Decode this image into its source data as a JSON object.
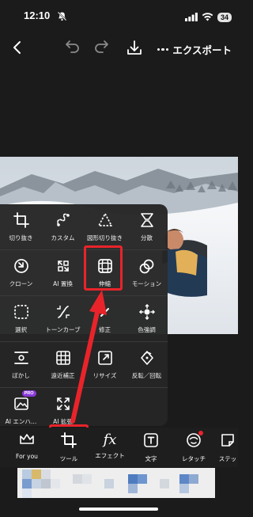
{
  "status": {
    "time": "12:10",
    "battery": "34"
  },
  "toolbar": {
    "export_label": "エクスポート"
  },
  "tools": [
    [
      {
        "label": "切り抜き",
        "icon": "crop-icon"
      },
      {
        "label": "カスタム",
        "icon": "custom-icon"
      },
      {
        "label": "図形切り抜き",
        "icon": "shape-crop-icon"
      },
      {
        "label": "分散",
        "icon": "disperse-icon"
      }
    ],
    [
      {
        "label": "クローン",
        "icon": "clone-icon"
      },
      {
        "label": "AI 置換",
        "icon": "ai-replace-icon"
      },
      {
        "label": "伸縮",
        "icon": "stretch-icon"
      },
      {
        "label": "モーション",
        "icon": "motion-icon"
      }
    ],
    [
      {
        "label": "選択",
        "icon": "select-icon"
      },
      {
        "label": "トーンカーブ",
        "icon": "tone-curve-icon"
      },
      {
        "label": "修正",
        "icon": "fix-icon"
      },
      {
        "label": "色強調",
        "icon": "color-enhance-icon"
      }
    ],
    [
      {
        "label": "ぼかし",
        "icon": "blur-icon"
      },
      {
        "label": "遠近補正",
        "icon": "perspective-icon"
      },
      {
        "label": "リサイズ",
        "icon": "resize-icon"
      },
      {
        "label": "反転／回転",
        "icon": "flip-rotate-icon"
      }
    ],
    [
      {
        "label": "AI エンハ…",
        "icon": "ai-enhance-icon",
        "badge": "PRO"
      },
      {
        "label": "AI 拡張",
        "icon": "ai-expand-icon"
      }
    ]
  ],
  "bottom_nav": [
    {
      "label": "For you",
      "icon": "crown-icon"
    },
    {
      "label": "ツール",
      "icon": "crop-tool-icon"
    },
    {
      "label": "エフェクト",
      "icon": "fx-icon"
    },
    {
      "label": "文字",
      "icon": "text-icon"
    },
    {
      "label": "レタッチ",
      "icon": "retouch-icon"
    },
    {
      "label": "ステッ",
      "icon": "sticker-icon"
    }
  ],
  "colors": {
    "highlight": "#e8242a",
    "pro_badge": "#8a3ad8"
  }
}
